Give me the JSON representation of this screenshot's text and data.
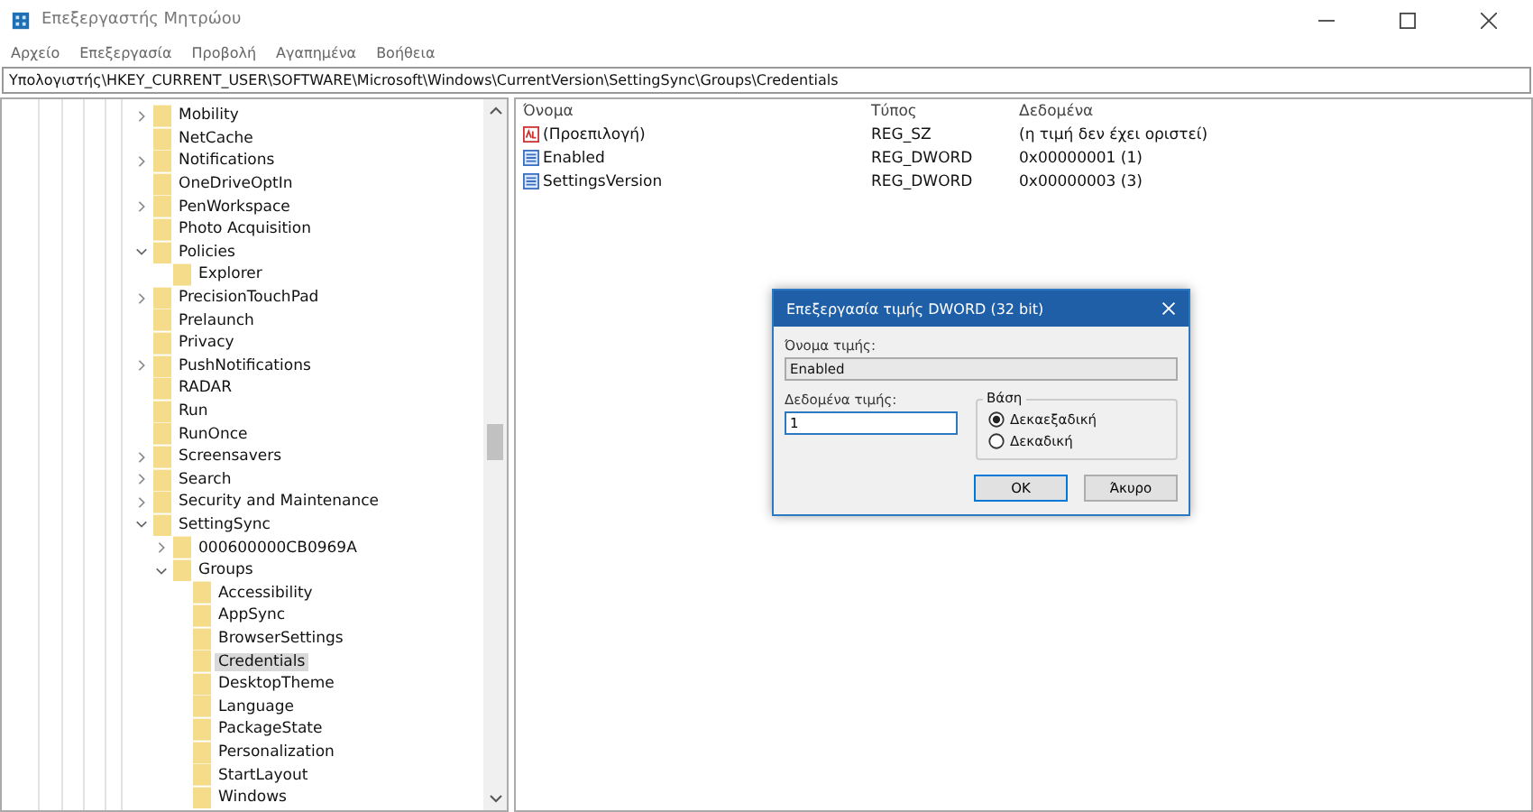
{
  "window": {
    "title": "Επεξεργαστής Μητρώου"
  },
  "menu": [
    "Αρχείο",
    "Επεξεργασία",
    "Προβολή",
    "Αγαπημένα",
    "Βοήθεια"
  ],
  "address": "Υπολογιστής\\HKEY_CURRENT_USER\\SOFTWARE\\Microsoft\\Windows\\CurrentVersion\\SettingSync\\Groups\\Credentials",
  "tree": {
    "items": [
      {
        "label": "Mobility",
        "expanded": false,
        "selected": false
      },
      {
        "label": "NetCache",
        "selected": false
      },
      {
        "label": "Notifications",
        "expanded": false,
        "selected": false
      },
      {
        "label": "OneDriveOptIn",
        "selected": false
      },
      {
        "label": "PenWorkspace",
        "expanded": false,
        "selected": false
      },
      {
        "label": "Photo Acquisition",
        "selected": false
      },
      {
        "label": "Policies",
        "expanded": true,
        "selected": false,
        "children": [
          {
            "label": "Explorer",
            "selected": false
          }
        ]
      },
      {
        "label": "PrecisionTouchPad",
        "expanded": false,
        "selected": false
      },
      {
        "label": "Prelaunch",
        "selected": false
      },
      {
        "label": "Privacy",
        "selected": false
      },
      {
        "label": "PushNotifications",
        "expanded": false,
        "selected": false
      },
      {
        "label": "RADAR",
        "selected": false
      },
      {
        "label": "Run",
        "selected": false
      },
      {
        "label": "RunOnce",
        "selected": false
      },
      {
        "label": "Screensavers",
        "expanded": false,
        "selected": false
      },
      {
        "label": "Search",
        "expanded": false,
        "selected": false
      },
      {
        "label": "Security and Maintenance",
        "expanded": false,
        "selected": false
      },
      {
        "label": "SettingSync",
        "expanded": true,
        "selected": false,
        "children": [
          {
            "label": "000600000CB0969A",
            "expanded": false,
            "selected": false
          },
          {
            "label": "Groups",
            "expanded": true,
            "selected": false,
            "children": [
              {
                "label": "Accessibility",
                "selected": false
              },
              {
                "label": "AppSync",
                "selected": false
              },
              {
                "label": "BrowserSettings",
                "selected": false
              },
              {
                "label": "Credentials",
                "selected": true
              },
              {
                "label": "DesktopTheme",
                "selected": false
              },
              {
                "label": "Language",
                "selected": false
              },
              {
                "label": "PackageState",
                "selected": false
              },
              {
                "label": "Personalization",
                "selected": false
              },
              {
                "label": "StartLayout",
                "selected": false
              },
              {
                "label": "Windows",
                "selected": false
              }
            ]
          }
        ]
      }
    ]
  },
  "values": {
    "columns": [
      "Όνομα",
      "Τύπος",
      "Δεδομένα"
    ],
    "rows": [
      {
        "kind": "string",
        "name": "(Προεπιλογή)",
        "type": "REG_SZ",
        "data": "(η τιμή δεν έχει οριστεί)"
      },
      {
        "kind": "binary",
        "name": "Enabled",
        "type": "REG_DWORD",
        "data": "0x00000001 (1)"
      },
      {
        "kind": "binary",
        "name": "SettingsVersion",
        "type": "REG_DWORD",
        "data": "0x00000003 (3)"
      }
    ]
  },
  "dialog": {
    "title": "Επεξεργασία τιμής DWORD (32 bit)",
    "name_label": "Όνομα τιμής:",
    "name_value": "Enabled",
    "data_label": "Δεδομένα τιμής:",
    "data_value": "1",
    "base_label": "Βάση",
    "bases": [
      {
        "label": "Δεκαεξαδική",
        "selected": true
      },
      {
        "label": "Δεκαδική",
        "selected": false
      }
    ],
    "buttons": [
      "OK",
      "Άκυρο"
    ]
  }
}
